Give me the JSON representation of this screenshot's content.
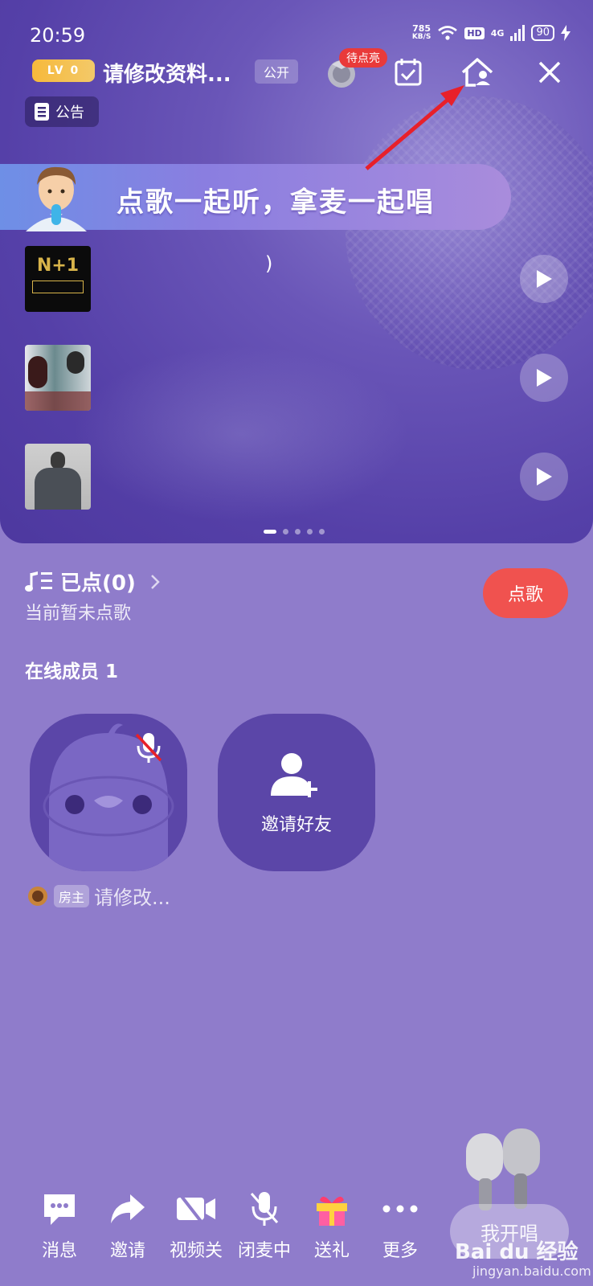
{
  "status_bar": {
    "time": "20:59",
    "net_speed_value": "785",
    "net_speed_unit": "KB/S",
    "hd": "HD",
    "signal": "4G",
    "battery": "90"
  },
  "header": {
    "level_badge": "LV 0",
    "room_title": "请修改资料...",
    "visibility_tag": "公开",
    "pending_badge": "待点亮"
  },
  "notice": {
    "label": "公告"
  },
  "banner": {
    "text": "点歌一起听，拿麦一起唱"
  },
  "songs": [
    {
      "title": ")",
      "subtitle": "",
      "cover_text": "N+1"
    },
    {
      "title": "",
      "subtitle": "",
      "cover_text": ""
    },
    {
      "title": "",
      "subtitle": "",
      "cover_text": ""
    }
  ],
  "pager": {
    "pages": 5,
    "active": 0
  },
  "queue": {
    "label": "已点(0)",
    "empty_text": "当前暂未点歌",
    "order_button": "点歌"
  },
  "members": {
    "title": "在线成员 1",
    "invite_label": "邀请好友",
    "host_tag": "房主",
    "host_name": "请修改..."
  },
  "toolbar": {
    "items": [
      {
        "label": "消息",
        "icon": "message-icon"
      },
      {
        "label": "邀请",
        "icon": "share-icon"
      },
      {
        "label": "视频关",
        "icon": "video-off-icon"
      },
      {
        "label": "闭麦中",
        "icon": "mic-off-icon"
      },
      {
        "label": "送礼",
        "icon": "gift-icon"
      },
      {
        "label": "更多",
        "icon": "more-icon"
      }
    ],
    "sing_button": "我开唱"
  },
  "watermark": {
    "brand": "Bai du 经验",
    "url": "jingyan.baidu.com"
  },
  "colors": {
    "background": "#8f7ccb",
    "panel": "#5540a8",
    "accent_red": "#f0524f",
    "badge_gold": "#f6b93b",
    "annotation_arrow": "#e8202a"
  }
}
